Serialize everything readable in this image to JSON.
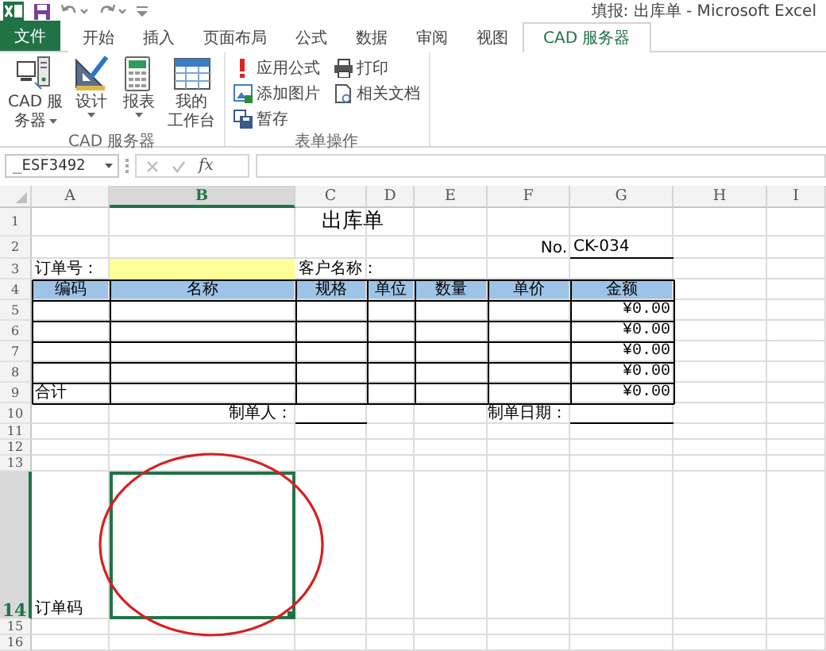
{
  "window": {
    "title": "填报: 出库单 - Microsoft Excel"
  },
  "tabs": [
    {
      "label": "文件",
      "kind": "file",
      "selected": false
    },
    {
      "label": "开始",
      "kind": "tab",
      "selected": false
    },
    {
      "label": "插入",
      "kind": "tab",
      "selected": false
    },
    {
      "label": "页面布局",
      "kind": "tab",
      "selected": false
    },
    {
      "label": "公式",
      "kind": "tab",
      "selected": false
    },
    {
      "label": "数据",
      "kind": "tab",
      "selected": false
    },
    {
      "label": "审阅",
      "kind": "tab",
      "selected": false
    },
    {
      "label": "视图",
      "kind": "tab",
      "selected": false
    },
    {
      "label": "CAD 服务器",
      "kind": "tab",
      "selected": true
    }
  ],
  "ribbon": {
    "groups": [
      {
        "label": "CAD 服务器",
        "kind": "large",
        "buttons": [
          {
            "lines": [
              "CAD 服",
              "务器"
            ],
            "dropdown": true
          },
          {
            "lines": [
              "设计"
            ],
            "dropdown": true
          },
          {
            "lines": [
              "报表"
            ],
            "dropdown": true
          },
          {
            "lines": [
              "我的",
              "工作台"
            ],
            "dropdown": false
          }
        ]
      },
      {
        "label": "表单操作",
        "kind": "small",
        "buttons": [
          {
            "lines": [
              "应用公式"
            ]
          },
          {
            "lines": [
              "添加图片"
            ]
          },
          {
            "lines": [
              "暂存"
            ]
          },
          {
            "lines": [
              "打印"
            ]
          },
          {
            "lines": [
              "相关文档"
            ]
          }
        ]
      }
    ]
  },
  "formula_bar": {
    "name_box": "_ESF3492",
    "function_label": "fx"
  },
  "sheet": {
    "columns": [
      {
        "label": "A",
        "selected": false
      },
      {
        "label": "B",
        "selected": true
      },
      {
        "label": "C",
        "selected": false
      },
      {
        "label": "D",
        "selected": false
      },
      {
        "label": "E",
        "selected": false
      },
      {
        "label": "F",
        "selected": false
      },
      {
        "label": "G",
        "selected": false
      },
      {
        "label": "H",
        "selected": false
      },
      {
        "label": "I",
        "selected": false
      }
    ],
    "rows": [
      {
        "label": "1",
        "selected": false
      },
      {
        "label": "2",
        "selected": false
      },
      {
        "label": "3",
        "selected": false
      },
      {
        "label": "4",
        "selected": false
      },
      {
        "label": "5",
        "selected": false
      },
      {
        "label": "6",
        "selected": false
      },
      {
        "label": "7",
        "selected": false
      },
      {
        "label": "8",
        "selected": false
      },
      {
        "label": "9",
        "selected": false
      },
      {
        "label": "10",
        "selected": false
      },
      {
        "label": "11",
        "selected": false
      },
      {
        "label": "12",
        "selected": false
      },
      {
        "label": "13",
        "selected": false
      },
      {
        "label": "14",
        "selected": true
      },
      {
        "label": "15",
        "selected": false
      },
      {
        "label": "16",
        "selected": false
      }
    ],
    "form": {
      "title": "出库单",
      "number_label": "No.",
      "number": "CK-034",
      "order_label": "订单号：",
      "customer_label": "客户名称：",
      "headers": [
        "编码",
        "名称",
        "规格",
        "单位",
        "数量",
        "单价",
        "金额"
      ],
      "amounts": [
        "¥0.00",
        "¥0.00",
        "¥0.00",
        "¥0.00"
      ],
      "total_label": "合计",
      "total_amount": "¥0.00",
      "maker_label": "制单人：",
      "date_label": "制单日期：",
      "barcode_label": "订单码"
    }
  }
}
